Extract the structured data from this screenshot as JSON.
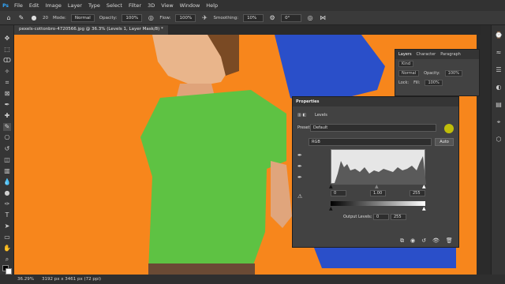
{
  "menu": [
    "File",
    "Edit",
    "Image",
    "Layer",
    "Type",
    "Select",
    "Filter",
    "3D",
    "View",
    "Window",
    "Help"
  ],
  "options": {
    "mode_label": "Mode:",
    "mode_value": "Normal",
    "opacity_label": "Opacity:",
    "opacity_value": "100%",
    "flow_label": "Flow:",
    "flow_value": "100%",
    "smoothing_label": "Smoothing:",
    "smoothing_value": "10%",
    "brush_size": "20",
    "angle_value": "0°"
  },
  "document": {
    "tab_title": "pexels-cottonbro-4720566.jpg @ 36.3% (Levels 1, Layer Mask/8) *"
  },
  "status": {
    "zoom": "36.29%",
    "dimensions": "3192 px x 3461 px (72 ppi)"
  },
  "layers_panel": {
    "tabs": [
      "Layers",
      "Character",
      "Paragraph"
    ],
    "kind_label": "Kind",
    "blend_mode": "Normal",
    "opacity_label": "Opacity:",
    "opacity_value": "100%",
    "lock_label": "Lock:",
    "fill_label": "Fill:",
    "fill_value": "100%"
  },
  "properties": {
    "title": "Properties",
    "adjustment": "Levels",
    "preset_label": "Preset:",
    "preset_value": "Default",
    "channel": "RGB",
    "auto_label": "Auto",
    "input_black": "0",
    "input_gamma": "1.00",
    "input_white": "255",
    "output_label": "Output Levels:",
    "output_black": "0",
    "output_white": "255"
  },
  "colors": {
    "canvas": "#f7861c",
    "shirt": "#5ec243",
    "blue_shirt": "#2a4fc9",
    "accent": "#31a8ff"
  }
}
